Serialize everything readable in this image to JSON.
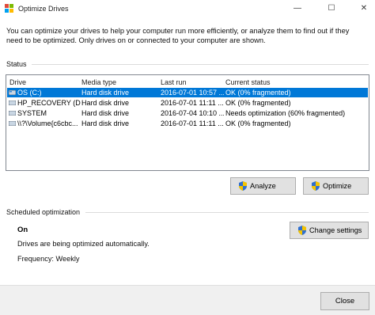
{
  "window": {
    "title": "Optimize Drives",
    "controls": {
      "minimize": "—",
      "maximize": "☐",
      "close": "✕"
    }
  },
  "intro_text": "You can optimize your drives to help your computer run more efficiently, or analyze them to find out if they need to be optimized. Only drives on or connected to your computer are shown.",
  "status": {
    "section_label": "Status",
    "columns": [
      "Drive",
      "Media type",
      "Last run",
      "Current status"
    ],
    "drives": [
      {
        "drive": "OS (C:)",
        "media_type": "Hard disk drive",
        "last_run": "2016-07-01 10:57 ...",
        "current_status": "OK (0% fragmented)",
        "selected": true
      },
      {
        "drive": "HP_RECOVERY (D:)",
        "media_type": "Hard disk drive",
        "last_run": "2016-07-01 11:11 ...",
        "current_status": "OK (0% fragmented)",
        "selected": false
      },
      {
        "drive": "SYSTEM",
        "media_type": "Hard disk drive",
        "last_run": "2016-07-04 10:10 ...",
        "current_status": "Needs optimization (60% fragmented)",
        "selected": false
      },
      {
        "drive": "\\\\?\\Volume{c6cbc...",
        "media_type": "Hard disk drive",
        "last_run": "2016-07-01 11:11 ...",
        "current_status": "OK (0% fragmented)",
        "selected": false
      }
    ],
    "analyze_label": "Analyze",
    "optimize_label": "Optimize"
  },
  "scheduled": {
    "section_label": "Scheduled optimization",
    "state": "On",
    "description": "Drives are being optimized automatically.",
    "frequency": "Frequency: Weekly",
    "change_settings_label": "Change settings"
  },
  "footer": {
    "close_label": "Close"
  },
  "colors": {
    "selection": "#0078d7",
    "button_face": "#e1e1e1",
    "footer_bg": "#f0f0f0"
  },
  "icons": {
    "app": "defrag-icon",
    "drive": "hard-drive-icon",
    "admin": "uac-shield-icon"
  }
}
